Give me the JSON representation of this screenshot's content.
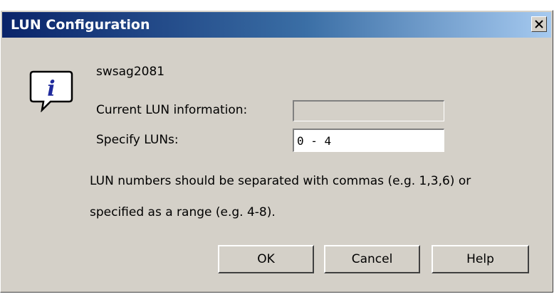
{
  "window": {
    "title": "LUN Configuration"
  },
  "colors": {
    "title_start": "#0a246a",
    "title_end": "#a6caf0",
    "dialog_bg": "#d4d0c8"
  },
  "icons": {
    "close": "close-icon",
    "info": "info-icon"
  },
  "content": {
    "server_name": "swsag2081",
    "current_label": "Current LUN information:",
    "current_value": "",
    "specify_label": "Specify LUNs:",
    "specify_value": "0 - 4",
    "note_line1": "LUN numbers should be separated with commas (e.g. 1,3,6) or",
    "note_line2": "specified as a range (e.g. 4-8)."
  },
  "buttons": {
    "ok": "OK",
    "cancel": "Cancel",
    "help": "Help"
  }
}
